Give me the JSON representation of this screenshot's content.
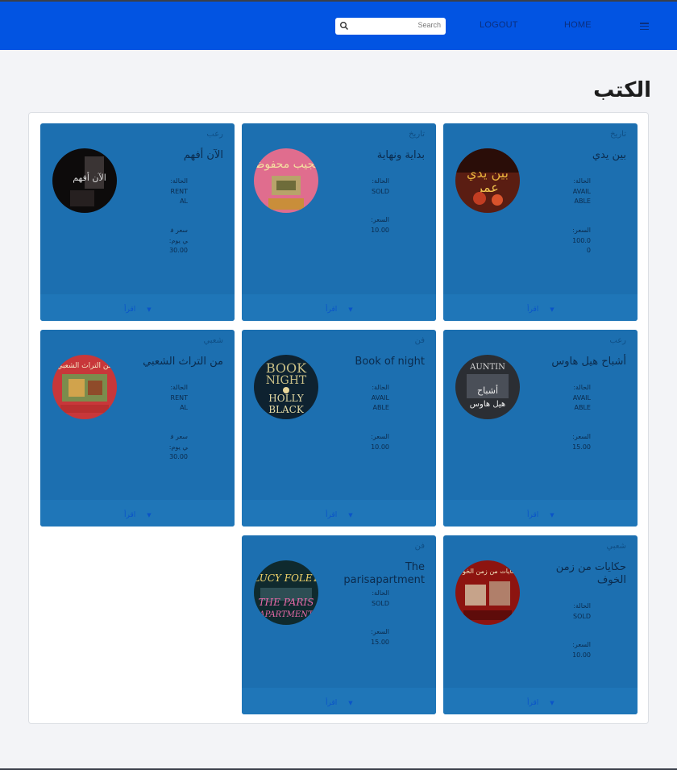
{
  "nav": {
    "search_placeholder": "Search",
    "logout_label": "LOGOUT",
    "home_label": "HOME",
    "menu_icon": "hamburger-icon",
    "search_icon": "search-icon"
  },
  "page": {
    "title": "الكتب"
  },
  "colors": {
    "navbar": "#0254e2",
    "card": "#1c6fb0",
    "page_bg": "#f3f4f7"
  },
  "books": [
    {
      "category": "تاريخ",
      "title": "بين يدي",
      "status_label": "الحالة:",
      "status": "AVAILABLE",
      "price_label": "السعر:",
      "price": "100.00",
      "read_label": "اقرأ",
      "cover_icon": "book-cover-image"
    },
    {
      "category": "تاريخ",
      "title": "بداية ونهاية",
      "status_label": "الحالة:",
      "status": "SOLD",
      "price_label": "السعر:",
      "price": "10.00",
      "read_label": "اقرأ",
      "cover_icon": "book-cover-image"
    },
    {
      "category": "رعب",
      "title": "الآن أفهم",
      "status_label": "الحالة:",
      "status": "RENTAL",
      "price_label": "سعر في يوم:",
      "price": "30.00",
      "read_label": "اقرأ",
      "cover_icon": "book-cover-image"
    },
    {
      "category": "رعب",
      "title": "أشباح هيل هاوس",
      "status_label": "الحالة:",
      "status": "AVAILABLE",
      "price_label": "السعر:",
      "price": "15.00",
      "read_label": "اقرأ",
      "cover_icon": "book-cover-image"
    },
    {
      "category": "فن",
      "title": "Book of night",
      "status_label": "الحالة:",
      "status": "AVAILABLE",
      "price_label": "السعر:",
      "price": "10.00",
      "read_label": "اقرأ",
      "cover_icon": "book-cover-image"
    },
    {
      "category": "شعبي",
      "title": "من التراث الشعبي",
      "status_label": "الحالة:",
      "status": "RENTAL",
      "price_label": "سعر في يوم:",
      "price": "30.00",
      "read_label": "اقرأ",
      "cover_icon": "book-cover-image"
    },
    {
      "category": "شعبي",
      "title": "حكايات من زمن الخوف",
      "status_label": "الحالة:",
      "status": "SOLD",
      "price_label": "السعر:",
      "price": "10.00",
      "read_label": "اقرأ",
      "cover_icon": "book-cover-image"
    },
    {
      "category": "فن",
      "title": "The parisapartment",
      "status_label": "الحالة:",
      "status": "SOLD",
      "price_label": "السعر:",
      "price": "15.00",
      "read_label": "اقرأ",
      "cover_icon": "book-cover-image"
    }
  ]
}
